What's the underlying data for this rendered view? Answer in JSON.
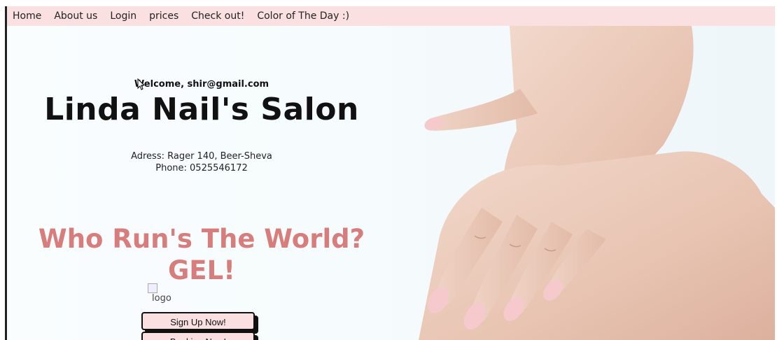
{
  "nav": {
    "items": [
      "Home",
      "About us",
      "Login",
      "prices",
      "Check out!",
      "Color of The Day :)"
    ]
  },
  "hero": {
    "welcome": "Welcome, shir@gmail.com",
    "title": "Linda Nail's Salon",
    "address": "Adress: Rager 140, Beer-Sheva",
    "phone": "Phone: 0525546172",
    "slogan_line1": "Who Run's The World?",
    "slogan_line2": "GEL!",
    "logo_alt": "logo"
  },
  "buttons": {
    "signup": "Sign Up Now!",
    "booking": "Booking Now!"
  },
  "colors": {
    "nav_bg": "#fbe0e2",
    "slogan": "#d77d7b",
    "button_bg": "#fbe0e2"
  }
}
